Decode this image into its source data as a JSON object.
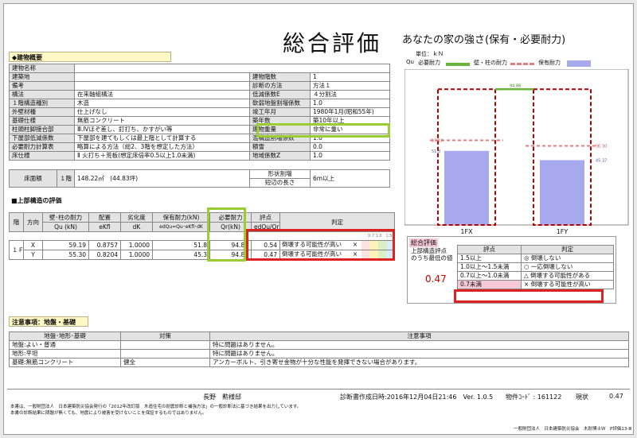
{
  "title": "総合評価",
  "building": {
    "header": "◆建物概要",
    "rows": [
      [
        "建物名称",
        "",
        "",
        ""
      ],
      [
        "建築地",
        "",
        "建物階数",
        "1"
      ],
      [
        "備考",
        "",
        "診断の方法",
        "方法１"
      ],
      [
        "構法",
        "在来軸組構法",
        "低減係数E",
        "４分割法"
      ],
      [
        "１階構造種別",
        "木造",
        "軟弱地盤割増係数",
        "1.0"
      ],
      [
        "外壁材種",
        "仕上げなし",
        "竣工年月",
        "1980年1月(昭和55年)"
      ],
      [
        "基礎仕様",
        "無筋コンクリート",
        "築年数",
        "築10年以上"
      ],
      [
        "柱頭柱脚接合部",
        "Ⅲ.Ⅳほぞ差し、釘打ち、かすがい等",
        "建物重量",
        "非常に重い"
      ],
      [
        "下屋部低減係数",
        "下屋部を建てもしくは最上階として計算する",
        "混構造割増係数",
        "1.0"
      ],
      [
        "必要耐力計算表",
        "略算による方法（総2、3階を想定した方法）",
        "積雪",
        "0.0"
      ],
      [
        "床仕様",
        "Ⅱ 火打ち＋荒板(想定床倍率0.5以上1.0未満)",
        "地域係数Z",
        "1.0"
      ]
    ],
    "floor_area_label": "床面積",
    "floor_level": "１階",
    "floor_area_value": "148.22㎡　(44.83坪)",
    "shape_label_1": "形状割増",
    "shape_label_2": "短辺の長さ",
    "shape_value": "6m以上"
  },
  "upper": {
    "header": "■上部構造の評価",
    "columns": [
      "階",
      "方向",
      "壁･柱の耐力",
      "Qu (kN)",
      "配置",
      "eKfl",
      "劣化度",
      "dK",
      "保有耐力(kN)",
      "edQu=Qu･eKfl･dK",
      "必要耐力",
      "Qr(kN)",
      "評点",
      "edQu/Qr",
      "判定"
    ],
    "scale": "0.7 1.0　1.5",
    "floor": "１Ｆ",
    "rows": [
      {
        "dir": "X",
        "qu": "59.19",
        "ekfl": "0.8757",
        "dk": "1.0000",
        "edqu": "51.8",
        "qr": "94.86",
        "score": "0.54",
        "judge": "倒壊する可能性が高い",
        "mark": "×"
      },
      {
        "dir": "Y",
        "qu": "55.30",
        "ekfl": "0.8204",
        "dk": "1.0000",
        "edqu": "45.3",
        "qr": "94.86",
        "score": "0.47",
        "judge": "倒壊する可能性が高い",
        "mark": "×"
      }
    ]
  },
  "summary": {
    "header": "総合評価",
    "label_1": "上部構造評点",
    "label_2": "のうち最低の値",
    "value": "0.47",
    "col_score": "評点",
    "col_judge": "判定",
    "rows": [
      {
        "score": "1.5以上",
        "judge": "◎ 倒壊しない"
      },
      {
        "score": "1.0以上～1.5未満",
        "judge": "○ 一応倒壊しない"
      },
      {
        "score": "0.7以上～1.0未満",
        "judge": "△ 倒壊する可能性がある"
      },
      {
        "score": "0.7未満",
        "judge": "× 倒壊する可能性が高い"
      }
    ]
  },
  "notes": {
    "header": "注意事項：地盤・基礎",
    "col_1": "地盤･地形･基礎",
    "col_2": "対策",
    "col_3": "注意事項",
    "rows": [
      [
        "地盤:よい・普通",
        "",
        "特に問題はありません。"
      ],
      [
        "地形:平坦",
        "",
        "特に問題はありません。"
      ],
      [
        "基礎:無筋コンクリート",
        "健全",
        "アンカーボルト、引き寄せ金物が十分な性能を発揮できない場合があります。"
      ]
    ]
  },
  "footer": {
    "name": "長野　勲様邸",
    "date": "診断書作成日時:2016年12月04日21:46　Ver. 1.0.5",
    "code": "物件ｺｰﾄﾞ : 161122",
    "current_label": "現状",
    "current_value": "0.47",
    "disclaimer_1": "本書は、一般財団法人　日本建築防災協会発行の「2012年改訂版　木造住宅の耐震診断と補強方法」の一般診断法に基づき結果を出力しています。",
    "disclaimer_2": "本書の診断結果に問題が無くても、地震により被害を受けないことを保証するものではありません。",
    "copyright": "一般財団法人　日本建築防災協会　木耐博士Ｗ　P評価13-Ⅲ"
  },
  "chart_data": {
    "type": "bar",
    "title": "あなたの家の強さ(保有・必要耐力)",
    "unit": "単位：ｋＮ",
    "legend": {
      "qu_label": "Qu",
      "required": "必要耐力",
      "wall": "壁・柱の耐力",
      "held": "保有耐力"
    },
    "categories": [
      "1FX",
      "1FY"
    ],
    "series": [
      {
        "name": "必要耐力",
        "values": [
          94.86,
          94.86
        ],
        "color": "#b00000"
      },
      {
        "name": "壁・柱の耐力",
        "values": [
          59.19,
          55.3
        ],
        "color": "#e08080"
      },
      {
        "name": "保有耐力",
        "values": [
          51.8,
          45.3
        ],
        "color": "#a8a8ee"
      }
    ],
    "value_labels": {
      "top": "94.86",
      "x_wall": "59.19",
      "x_held": "51.8",
      "y_wall": "55.30",
      "y_held": "45.37"
    },
    "wall_line_color": "#6ab43c",
    "ylim": [
      0,
      100
    ]
  }
}
